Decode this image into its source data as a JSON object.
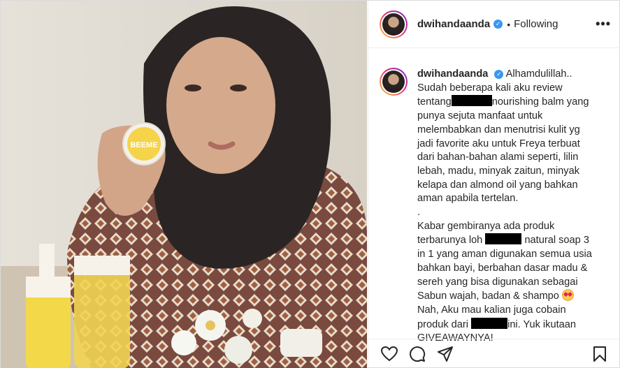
{
  "post": {
    "username": "dwihandaanda",
    "verified_icon": "verified-badge-icon",
    "separator": "•",
    "follow_status": "Following",
    "more_icon": "•••"
  },
  "product_label": "BEEME",
  "caption": {
    "username": "dwihandaanda",
    "lines": [
      "Alhamdulillah..",
      "Sudah beberapa kali aku review",
      "tentang",
      "nourishing balm yang",
      "punya sejuta manfaat untuk",
      "melembabkan dan menutrisi kulit yg",
      "jadi favorite aku untuk Freya terbuat",
      "dari bahan-bahan alami seperti, lilin",
      "lebah, madu, minyak zaitun, minyak",
      "kelapa dan almond oil yang bahkan",
      "aman apabila tertelan.",
      ".",
      "Kabar gembiranya ada produk",
      "terbarunya loh",
      "natural soap 3",
      "in 1 yang aman digunakan semua usia",
      "bahkan bayi, berbahan dasar madu &",
      "sereh yang bisa digunakan sebagai",
      "Sabun wajah, badan & shampo",
      "Nah, Aku mau kalian juga cobain",
      "produk dari",
      "ini. Yuk ikutaan",
      "GIVEAWAYNYA!"
    ]
  },
  "actions": {
    "like_icon": "heart-icon",
    "comment_icon": "comment-icon",
    "share_icon": "share-icon",
    "save_icon": "bookmark-icon"
  },
  "colors": {
    "text": "#262626",
    "verified": "#3897f0",
    "border": "#efefef"
  }
}
